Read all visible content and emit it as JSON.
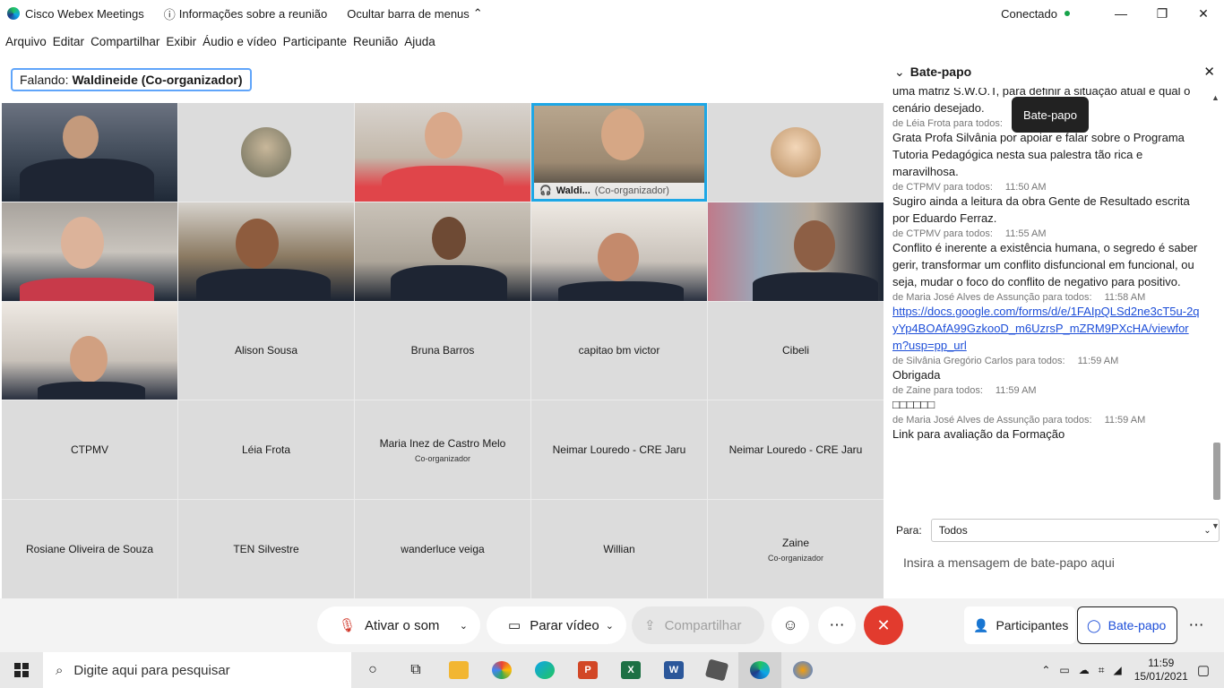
{
  "titlebar": {
    "app_name": "Cisco Webex Meetings",
    "meeting_info": "Informações sobre a reunião",
    "hide_menu": "Ocultar barra de menus",
    "status": "Conectado"
  },
  "menu": [
    "Arquivo",
    "Editar",
    "Compartilhar",
    "Exibir",
    "Áudio e vídeo",
    "Participante",
    "Reunião",
    "Ajuda"
  ],
  "speaking": {
    "label": "Falando:",
    "name": "Waldineide (Co-organizador)"
  },
  "active_tile": {
    "name": "Waldi...",
    "role": "(Co-organizador)"
  },
  "participants": {
    "row3": [
      "Alison Sousa",
      "Bruna Barros",
      "capitao bm victor",
      "Cibeli"
    ],
    "row4": [
      {
        "name": "CTPMV",
        "role": ""
      },
      {
        "name": "Léia Frota",
        "role": ""
      },
      {
        "name": "Maria Inez de Castro Melo",
        "role": "Co-organizador"
      },
      {
        "name": "Neimar Louredo - CRE Jaru",
        "role": ""
      },
      {
        "name": "Neimar Louredo - CRE Jaru",
        "role": ""
      }
    ],
    "row5": [
      {
        "name": "Rosiane Oliveira de Souza",
        "role": ""
      },
      {
        "name": "TEN Silvestre",
        "role": ""
      },
      {
        "name": "wanderluce veiga",
        "role": ""
      },
      {
        "name": "Willian",
        "role": ""
      },
      {
        "name": "Zaine",
        "role": "Co-organizador"
      }
    ]
  },
  "chat": {
    "title": "Bate-papo",
    "tooltip": "Bate-papo",
    "messages": [
      {
        "meta": "",
        "time": "",
        "text": "uma matriz S.W.O.T, para definir a situação atual e qual o cenário desejado."
      },
      {
        "meta": "de Léia Frota para todos:",
        "time": "",
        "text": "Grata Profa Silvânia por apoiar e falar sobre o Programa Tutoria Pedagógica nesta sua palestra tão rica e maravilhosa."
      },
      {
        "meta": "de CTPMV para todos:",
        "time": "11:50 AM",
        "text": "Sugiro ainda a leitura da obra Gente de Resultado escrita por Eduardo Ferraz."
      },
      {
        "meta": "de CTPMV para todos:",
        "time": "11:55 AM",
        "text": "Conflito é inerente a existência humana, o segredo é saber gerir, transformar um conflito disfuncional em funcional, ou seja, mudar o foco do conflito de negativo para positivo."
      },
      {
        "meta": "de Maria José Alves de Assunção para todos:",
        "time": "11:58 AM",
        "link": "https://docs.google.com/forms/d/e/1FAIpQLSd2ne3cT5u-2qyYp4BOAfA99GzkooD_m6UzrsP_mZRM9PXcHA/viewform?usp=pp_url"
      },
      {
        "meta": "de Silvânia Gregório Carlos para todos:",
        "time": "11:59 AM",
        "text": "Obrigada"
      },
      {
        "meta": "de Zaine para todos:",
        "time": "11:59 AM",
        "text": "□□□□□□"
      },
      {
        "meta": "de Maria José Alves de Assunção para todos:",
        "time": "11:59 AM",
        "text": "Link para avaliação da Formação"
      }
    ],
    "to_label": "Para:",
    "to_value": "Todos",
    "input_placeholder": "Insira a mensagem de bate-papo aqui"
  },
  "controls": {
    "mute": "Ativar o som",
    "video": "Parar vídeo",
    "share": "Compartilhar",
    "participants": "Participantes",
    "chat": "Bate-papo"
  },
  "taskbar": {
    "search_placeholder": "Digite aqui para pesquisar",
    "time": "11:59",
    "date": "15/01/2021"
  },
  "colors": {
    "accent": "#1ea7e5",
    "end_call": "#e23b2e",
    "link": "#1d4ed8",
    "connected": "#16a34a"
  }
}
